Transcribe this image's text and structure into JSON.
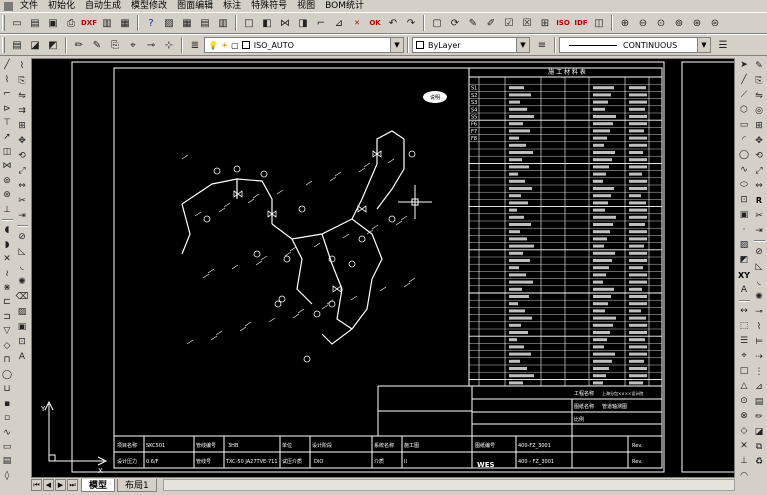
{
  "menu": {
    "items": [
      "文件",
      "初始化",
      "自动生成",
      "模型修改",
      "图面编辑",
      "标注",
      "特殊符号",
      "视图",
      "BOM统计"
    ]
  },
  "toolbar1": {
    "dxf_label": "DXF",
    "ok_label": "OK",
    "iso_label": "ISO",
    "idf_label": "IDF"
  },
  "toolbar2": {
    "layer_name": "ISO_AUTO",
    "color_name": "ByLayer",
    "linetype_name": "CONTINUOUS"
  },
  "right_toolbar": {
    "r_label": "R",
    "xy_label": "XY"
  },
  "tabs": {
    "model": "模型",
    "layout1": "布局1"
  },
  "drawing": {
    "table_title": "施 工 材 料 表",
    "stamp": "说明",
    "title_block": {
      "project_label": "项目名称",
      "project_value": "SKC501",
      "drawing_label": "管线编号",
      "drawing_value": "3HB",
      "unit_label": "单位",
      "design_label": "设计阶段",
      "design_value": "施工图",
      "system_label": "系统名称",
      "system_value": "施工图",
      "pressure_label": "设计压力",
      "pressure_value": "0.6/F",
      "line_label": "管线号",
      "line_value": "TXC-50 JA27TVE-711",
      "test_label": "试压介质",
      "test_value": "DIO",
      "material_label": "介质",
      "material_value": "II",
      "drawing_no_label": "图纸编号",
      "drawing_no_value": "400-FZ_3001",
      "sheet_value": "400 - FZ_3001",
      "brand": "WES",
      "rev_label": "Rev.",
      "company_label": "工程名称",
      "company_value": "上海分包××××设计院",
      "subtitle_label": "图纸名称",
      "subtitle_value": "管道轴测图",
      "scale_label": "比例"
    },
    "right_table_rows": [
      "S1",
      "S2",
      "S3",
      "S4",
      "S5",
      "F6",
      "F7",
      "F8"
    ]
  }
}
